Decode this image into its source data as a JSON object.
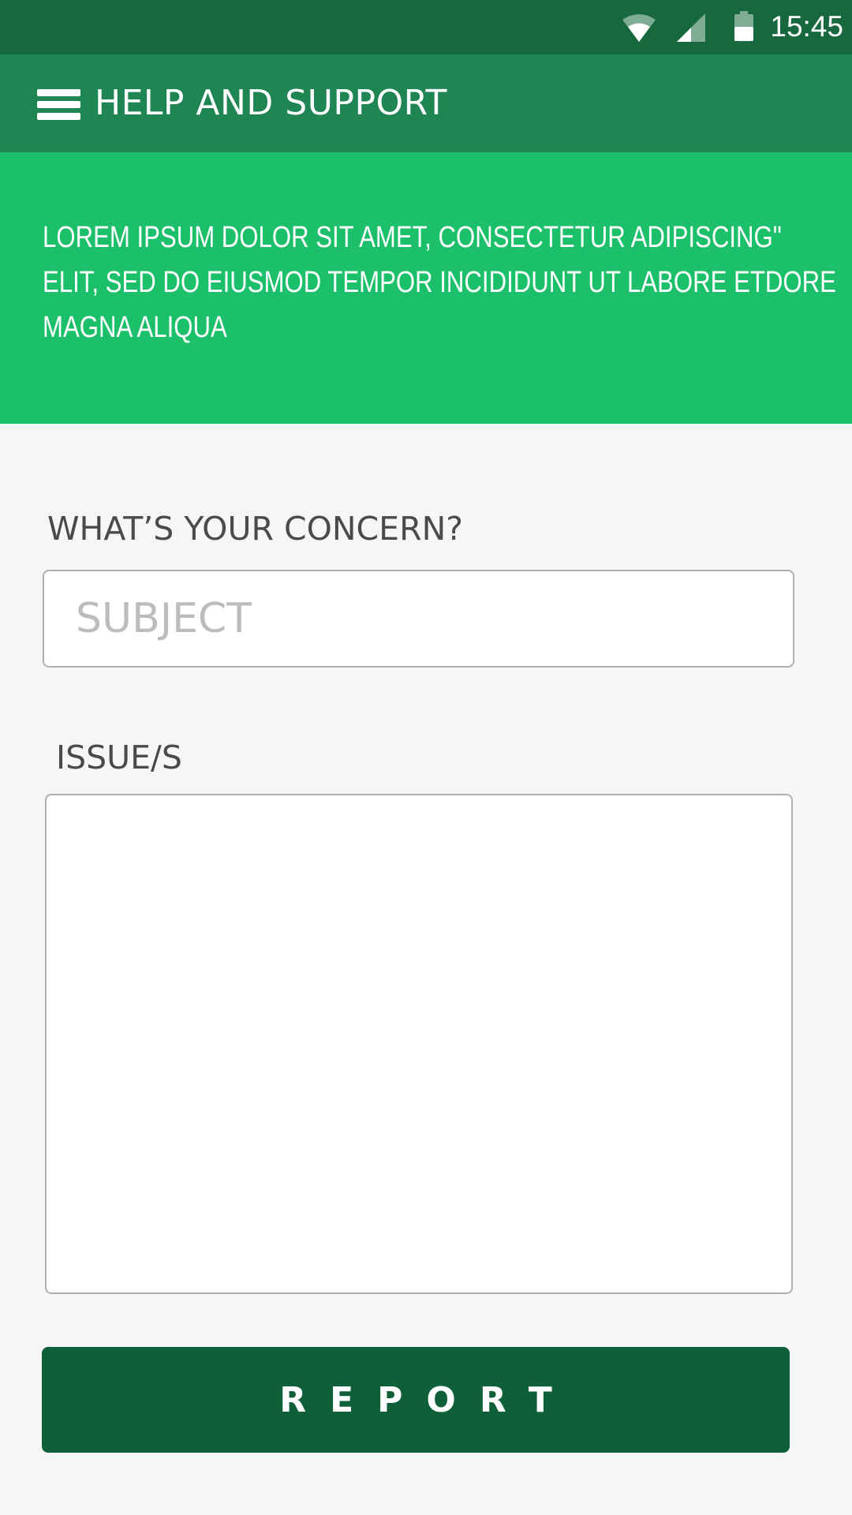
{
  "status_bar": {
    "time": "15:45",
    "icons": [
      "wifi-icon",
      "cell-signal-icon",
      "battery-icon"
    ]
  },
  "app_bar": {
    "title": "HELP AND SUPPORT",
    "menu_icon": "hamburger-menu-icon"
  },
  "banner": {
    "lines": [
      "LOREM IPSUM DOLOR SIT AMET, CONSECTETUR ADIPISCING\"",
      "ELIT, SED DO EIUSMOD TEMPOR INCIDIDUNT UT LABORE ETDORE",
      "MAGNA ALIQUA"
    ]
  },
  "form": {
    "concern_label": "WHAT’S YOUR CONCERN?",
    "subject_placeholder": "SUBJECT",
    "subject_value": "",
    "issue_label": "ISSUE/S",
    "issue_value": "",
    "report_label": "REPORT"
  },
  "colors": {
    "status_bar": "#17683f",
    "app_bar": "#1e8553",
    "banner": "#1cc06a",
    "background": "#f6f6f6",
    "button": "#0f5f38",
    "label_text": "#4a4a4a",
    "placeholder": "#bcbcbc"
  }
}
